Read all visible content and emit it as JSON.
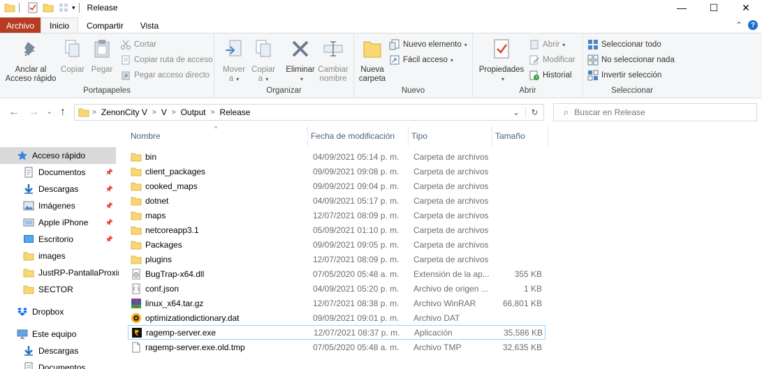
{
  "window": {
    "title": "Release",
    "minimize": "—",
    "maximize": "☐",
    "close": "✕"
  },
  "tabs": [
    "Archivo",
    "Inicio",
    "Compartir",
    "Vista"
  ],
  "tabs_right": {
    "expand": "⌃",
    "help": "?"
  },
  "ribbon": {
    "portapapeles": {
      "label": "Portapapeles",
      "pin_line1": "Anclar al",
      "pin_line2": "Acceso rápido",
      "copy": "Copiar",
      "paste": "Pegar",
      "cut": "Cortar",
      "copy_path": "Copiar ruta de acceso",
      "paste_shortcut": "Pegar acceso directo"
    },
    "organizar": {
      "label": "Organizar",
      "move_line1": "Mover",
      "move_line2": "a",
      "copy_line1": "Copiar",
      "copy_line2": "a",
      "delete": "Eliminar",
      "rename_line1": "Cambiar",
      "rename_line2": "nombre"
    },
    "nuevo": {
      "label": "Nuevo",
      "new_folder_line1": "Nueva",
      "new_folder_line2": "carpeta",
      "new_item": "Nuevo elemento",
      "easy_access": "Fácil acceso"
    },
    "abrir": {
      "label": "Abrir",
      "properties": "Propiedades",
      "open": "Abrir",
      "edit": "Modificar",
      "history": "Historial"
    },
    "seleccionar": {
      "label": "Seleccionar",
      "select_all": "Seleccionar todo",
      "select_none": "No seleccionar nada",
      "invert": "Invertir selección"
    }
  },
  "navigation": {
    "back": "←",
    "forward": "→",
    "recent": "⌄",
    "up": "↑",
    "breadcrumb": [
      "ZenonCity V",
      "V",
      "Output",
      "Release"
    ],
    "search_placeholder": "Buscar en Release"
  },
  "sidebar": [
    {
      "label": "Acceso rápido",
      "icon": "star-icon",
      "pinned": false,
      "selected": true
    },
    {
      "label": "Documentos",
      "icon": "documents-icon",
      "pinned": true
    },
    {
      "label": "Descargas",
      "icon": "download-icon",
      "pinned": true
    },
    {
      "label": "Imágenes",
      "icon": "pictures-icon",
      "pinned": true
    },
    {
      "label": "Apple iPhone",
      "icon": "phone-icon",
      "pinned": true
    },
    {
      "label": "Escritorio",
      "icon": "desktop-icon",
      "pinned": true
    },
    {
      "label": "images",
      "icon": "folder-icon",
      "pinned": false
    },
    {
      "label": "JustRP-PantallaProxim",
      "icon": "folder-icon",
      "pinned": false
    },
    {
      "label": "SECTOR",
      "icon": "folder-icon",
      "pinned": false
    },
    {
      "label": "Dropbox",
      "icon": "dropbox-icon",
      "pinned": false
    },
    {
      "label": "Este equipo",
      "icon": "computer-icon",
      "pinned": false
    },
    {
      "label": "Descargas",
      "icon": "download-icon",
      "pinned": false
    },
    {
      "label": "Documentos",
      "icon": "documents-icon",
      "pinned": false
    }
  ],
  "columns": {
    "name": "Nombre",
    "date": "Fecha de modificación",
    "type": "Tipo",
    "size": "Tamaño"
  },
  "files": [
    {
      "name": "bin",
      "date": "04/09/2021 05:14 p. m.",
      "type": "Carpeta de archivos",
      "size": "",
      "icon": "folder-icon"
    },
    {
      "name": "client_packages",
      "date": "09/09/2021 09:08 p. m.",
      "type": "Carpeta de archivos",
      "size": "",
      "icon": "folder-icon"
    },
    {
      "name": "cooked_maps",
      "date": "09/09/2021 09:04 p. m.",
      "type": "Carpeta de archivos",
      "size": "",
      "icon": "folder-icon"
    },
    {
      "name": "dotnet",
      "date": "04/09/2021 05:17 p. m.",
      "type": "Carpeta de archivos",
      "size": "",
      "icon": "folder-icon"
    },
    {
      "name": "maps",
      "date": "12/07/2021 08:09 p. m.",
      "type": "Carpeta de archivos",
      "size": "",
      "icon": "folder-icon"
    },
    {
      "name": "netcoreapp3.1",
      "date": "05/09/2021 01:10 p. m.",
      "type": "Carpeta de archivos",
      "size": "",
      "icon": "folder-icon"
    },
    {
      "name": "Packages",
      "date": "09/09/2021 09:05 p. m.",
      "type": "Carpeta de archivos",
      "size": "",
      "icon": "folder-icon"
    },
    {
      "name": "plugins",
      "date": "12/07/2021 08:09 p. m.",
      "type": "Carpeta de archivos",
      "size": "",
      "icon": "folder-icon"
    },
    {
      "name": "BugTrap-x64.dll",
      "date": "07/05/2020 05:48 a. m.",
      "type": "Extensión de la ap...",
      "size": "355 KB",
      "icon": "dll-icon"
    },
    {
      "name": "conf.json",
      "date": "04/09/2021 05:20 p. m.",
      "type": "Archivo de origen ...",
      "size": "1 KB",
      "icon": "json-file-icon"
    },
    {
      "name": "linux_x64.tar.gz",
      "date": "12/07/2021 08:38 p. m.",
      "type": "Archivo WinRAR",
      "size": "66,801 KB",
      "icon": "winrar-icon"
    },
    {
      "name": "optimizationdictionary.dat",
      "date": "09/09/2021 09:01 p. m.",
      "type": "Archivo DAT",
      "size": "",
      "icon": "dat-file-icon"
    },
    {
      "name": "ragemp-server.exe",
      "date": "12/07/2021 08:37 p. m.",
      "type": "Aplicación",
      "size": "35,586 KB",
      "icon": "ragemp-icon",
      "highlight": true
    },
    {
      "name": "ragemp-server.exe.old.tmp",
      "date": "07/05/2020 05:48 a. m.",
      "type": "Archivo TMP",
      "size": "32,635 KB",
      "icon": "tmp-file-icon"
    }
  ]
}
